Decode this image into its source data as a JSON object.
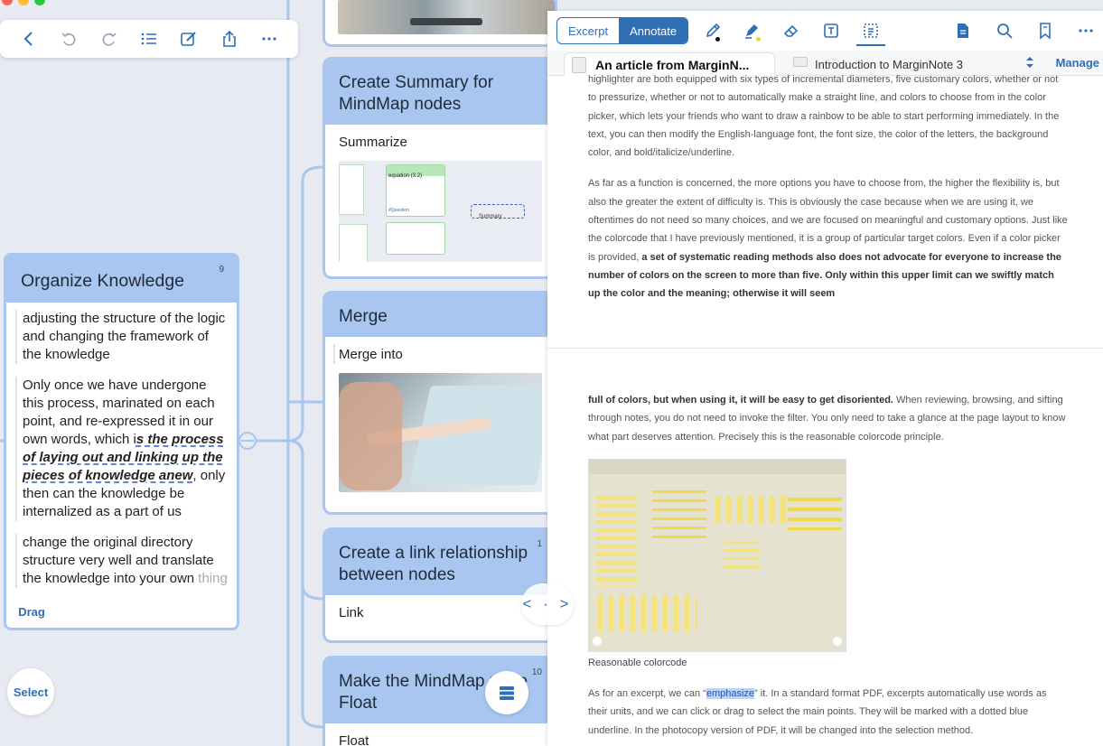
{
  "left_toolbar": {
    "icons": [
      "back-icon",
      "undo-icon",
      "redo-icon",
      "outline-icon",
      "edit-icon",
      "share-icon",
      "more-icon"
    ]
  },
  "nodes": {
    "summary": {
      "title": "Create Summary for MindMap nodes",
      "body": "Summarize",
      "thumb_labels": [
        "Summary",
        "equation (3.2)",
        "#Question"
      ]
    },
    "merge": {
      "title": "Merge",
      "body": "Merge into"
    },
    "link": {
      "title": "Create a link relationship between nodes",
      "count": "1",
      "body": "Link"
    },
    "float": {
      "title": "Make the MindMap node Float",
      "count": "10",
      "body": "Float"
    },
    "organize": {
      "title": "Organize Knowledge",
      "count": "9",
      "seg1": "adjusting the structure of the logic and changing the framework of the knowledge",
      "seg2_a": "Only once we have undergone this process, marinated on each point, and re-expressed it in our own words, which i",
      "seg2_hl": "s the process of laying out and linking up the pieces of knowledge anew",
      "seg2_b": ", only then can the knowledge be internalized as a part of us",
      "seg3": "change the original directory structure very well and translate the knowledge into your own",
      "seg3_fade": "thing"
    }
  },
  "buttons": {
    "drag": "Drag",
    "select": "Select",
    "split": "< · >"
  },
  "doc": {
    "mode_excerpt": "Excerpt",
    "mode_annotate": "Annotate",
    "manage": "Manage",
    "tabs": [
      "An article from MarginN...",
      "Introduction to MarginNote 3"
    ],
    "colors": {
      "pen_dot": "#111111",
      "highlighter_dot": "#f1d91b",
      "accent": "#2f6fb5"
    },
    "page1": {
      "p1": "highlighter are both equipped with six types of incremental diameters, five customary colors, whether or not to pressurize, whether or not to automatically make a straight line, and colors to choose from in the color picker, which lets your friends who want to draw a rainbow to be able to start performing immediately. In the text, you can then modify the English-language font, the font size, the color of the letters, the background color, and bold/italicize/underline.",
      "p2": "As far as a function is concerned, the more options you have to choose from, the higher the flexibility is, but also the greater the extent of difficulty is. This is obviously the case because when we are using it, we oftentimes do not need so many choices, and we are focused on meaningful and customary options. Just like the colorcode that I have previously mentioned, it is a group of particular target colors. Even if a color picker is provided, ",
      "p2_bold": "a set of systematic reading methods also does not advocate for everyone to increase the number of colors on the screen to more than five. Only within this upper limit can we swiftly match up the color and the meaning; otherwise it will seem"
    },
    "page2": {
      "p1_bold": "full of colors, but when using it, it will be easy to get disoriented.",
      "p1": " When reviewing, browsing, and sifting through notes, you do not need to invoke the filter. You only need to take a glance at the page layout to know what part deserves attention. Precisely this is the reasonable colorcode principle.",
      "caption": "Reasonable colorcode",
      "p2_a": "As for an excerpt, we can “",
      "p2_sel": "emphasize",
      "p2_b": "” it. In a standard format PDF, excerpts automatically use words as their units, and we can click or drag to select the main points. They will be marked with a dotted blue underline. In the photocopy version of PDF, it will be changed into the selection method."
    }
  }
}
